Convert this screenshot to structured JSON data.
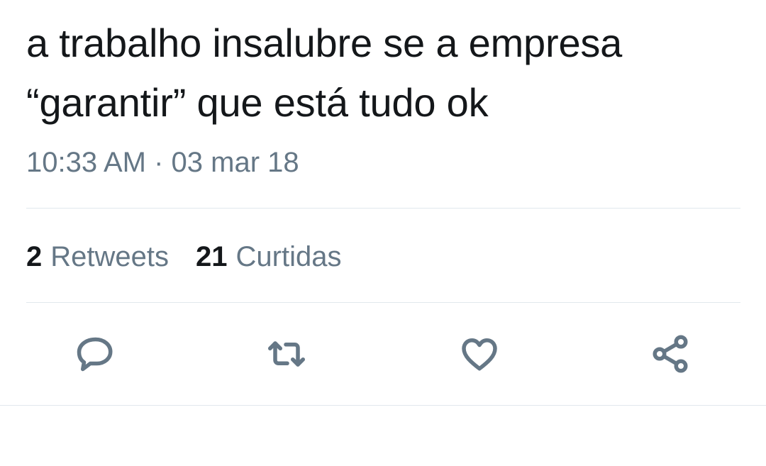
{
  "tweet": {
    "text_lines": [
      "a trabalho insalubre se a empresa",
      "“garantir” que está tudo ok"
    ],
    "timestamp": "10:33 AM · 03 mar 18"
  },
  "stats": {
    "retweets": {
      "count": "2",
      "label": "Retweets"
    },
    "likes": {
      "count": "21",
      "label": "Curtidas"
    }
  },
  "actions": [
    {
      "name": "reply",
      "icon": "reply-icon"
    },
    {
      "name": "retweet",
      "icon": "retweet-icon"
    },
    {
      "name": "like",
      "icon": "heart-icon"
    },
    {
      "name": "share",
      "icon": "share-icon"
    }
  ],
  "colors": {
    "text": "#14171a",
    "secondary": "#657786",
    "divider": "#e1e8ed",
    "background": "#ffffff"
  }
}
